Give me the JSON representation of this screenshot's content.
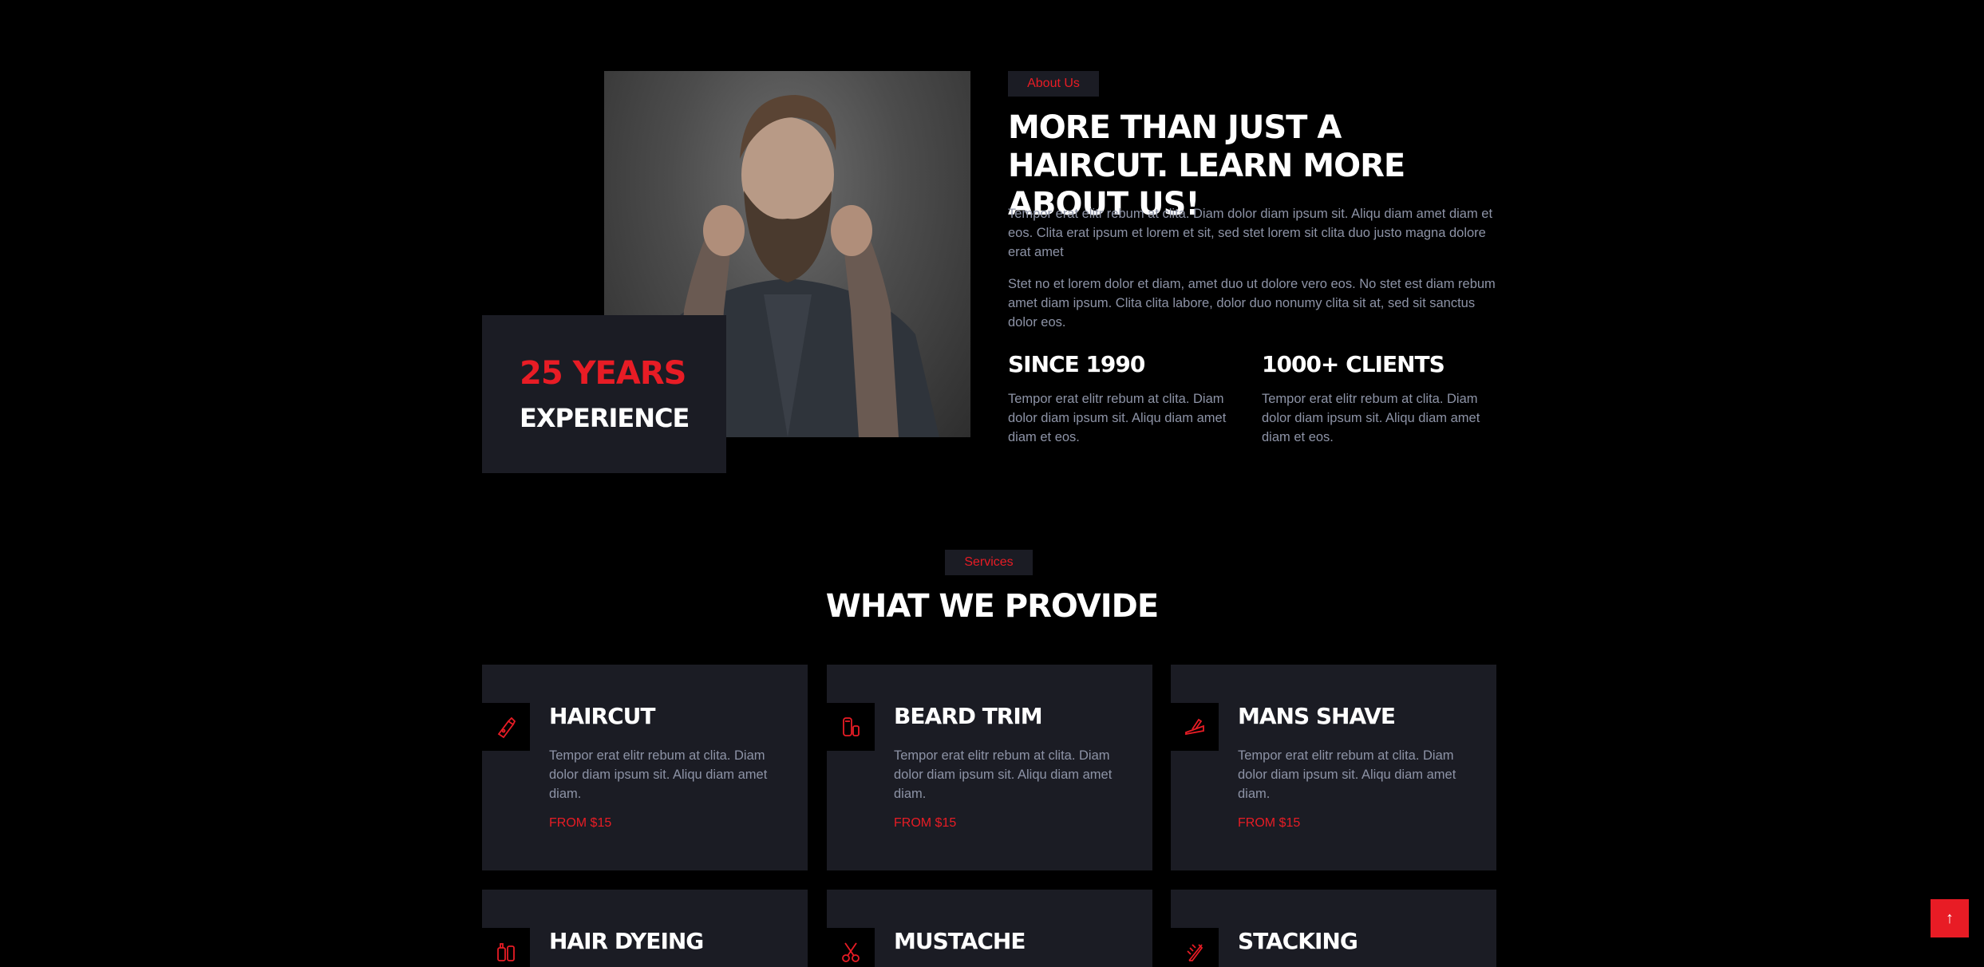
{
  "about": {
    "tag": "About Us",
    "title": "MORE THAN JUST A HAIRCUT. LEARN MORE ABOUT US!",
    "para1": "Tempor erat elitr rebum at clita. Diam dolor diam ipsum sit. Aliqu diam amet diam et eos. Clita erat ipsum et lorem et sit, sed stet lorem sit clita duo justo magna dolore erat amet",
    "para2": "Stet no et lorem dolor et diam, amet duo ut dolore vero eos. No stet est diam rebum amet diam ipsum. Clita clita labore, dolor duo nonumy clita sit at, sed sit sanctus dolor eos.",
    "experience_years": "25 YEARS",
    "experience_label": "EXPERIENCE",
    "stats": [
      {
        "title": "SINCE 1990",
        "text": "Tempor erat elitr rebum at clita. Diam dolor diam ipsum sit. Aliqu diam amet diam et eos."
      },
      {
        "title": "1000+ CLIENTS",
        "text": "Tempor erat elitr rebum at clita. Diam dolor diam ipsum sit. Aliqu diam amet diam et eos."
      }
    ]
  },
  "services": {
    "tag": "Services",
    "title": "WHAT WE PROVIDE",
    "items": [
      {
        "title": "HAIRCUT",
        "icon": "clipper-icon",
        "text": "Tempor erat elitr rebum at clita. Diam dolor diam ipsum sit. Aliqu diam amet diam.",
        "price": "FROM $15"
      },
      {
        "title": "BEARD TRIM",
        "icon": "beard-trimmer-icon",
        "text": "Tempor erat elitr rebum at clita. Diam dolor diam ipsum sit. Aliqu diam amet diam.",
        "price": "FROM $15"
      },
      {
        "title": "MANS SHAVE",
        "icon": "razor-icon",
        "text": "Tempor erat elitr rebum at clita. Diam dolor diam ipsum sit. Aliqu diam amet diam.",
        "price": "FROM $15"
      },
      {
        "title": "HAIR DYEING",
        "icon": "dye-bottle-icon"
      },
      {
        "title": "MUSTACHE",
        "icon": "scissors-icon"
      },
      {
        "title": "STACKING",
        "icon": "comb-icon"
      }
    ]
  },
  "back_to_top": {
    "label": "↑"
  },
  "colors": {
    "accent": "#e81c25",
    "card_bg": "#1b1c24",
    "page_bg": "#000000",
    "body_text": "#8d93a6"
  }
}
